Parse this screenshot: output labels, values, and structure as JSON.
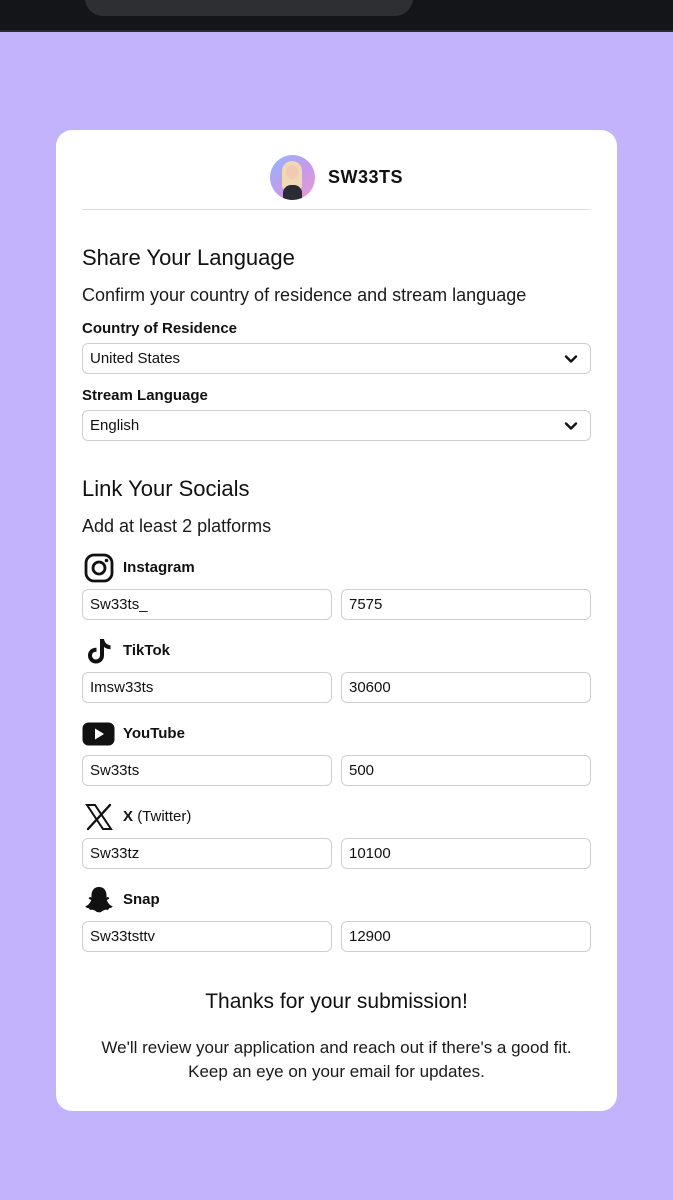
{
  "profile": {
    "username": "SW33TS"
  },
  "language_section": {
    "title": "Share Your Language",
    "subtitle": "Confirm your country of residence and stream language",
    "country_label": "Country of Residence",
    "country_value": "United States",
    "language_label": "Stream Language",
    "language_value": "English"
  },
  "socials_section": {
    "title": "Link Your Socials",
    "subtitle": "Add at least 2 platforms",
    "platforms": [
      {
        "name": "Instagram",
        "extra": "",
        "icon": "instagram-icon",
        "handle": "Sw33ts_",
        "count": "7575"
      },
      {
        "name": "TikTok",
        "extra": "",
        "icon": "tiktok-icon",
        "handle": "Imsw33ts",
        "count": "30600"
      },
      {
        "name": "YouTube",
        "extra": "",
        "icon": "youtube-icon",
        "handle": "Sw33ts",
        "count": "500"
      },
      {
        "name": "X",
        "extra": "(Twitter)",
        "icon": "x-icon",
        "handle": "Sw33tz",
        "count": "10100"
      },
      {
        "name": "Snap",
        "extra": "",
        "icon": "snapchat-icon",
        "handle": "Sw33tsttv",
        "count": "12900"
      }
    ]
  },
  "confirmation": {
    "title": "Thanks for your submission!",
    "message": "We'll review your application and reach out if there's a good fit. Keep an eye on your email for updates."
  },
  "colors": {
    "background": "#c3b3fc",
    "card": "#ffffff",
    "topbar": "#141518"
  }
}
